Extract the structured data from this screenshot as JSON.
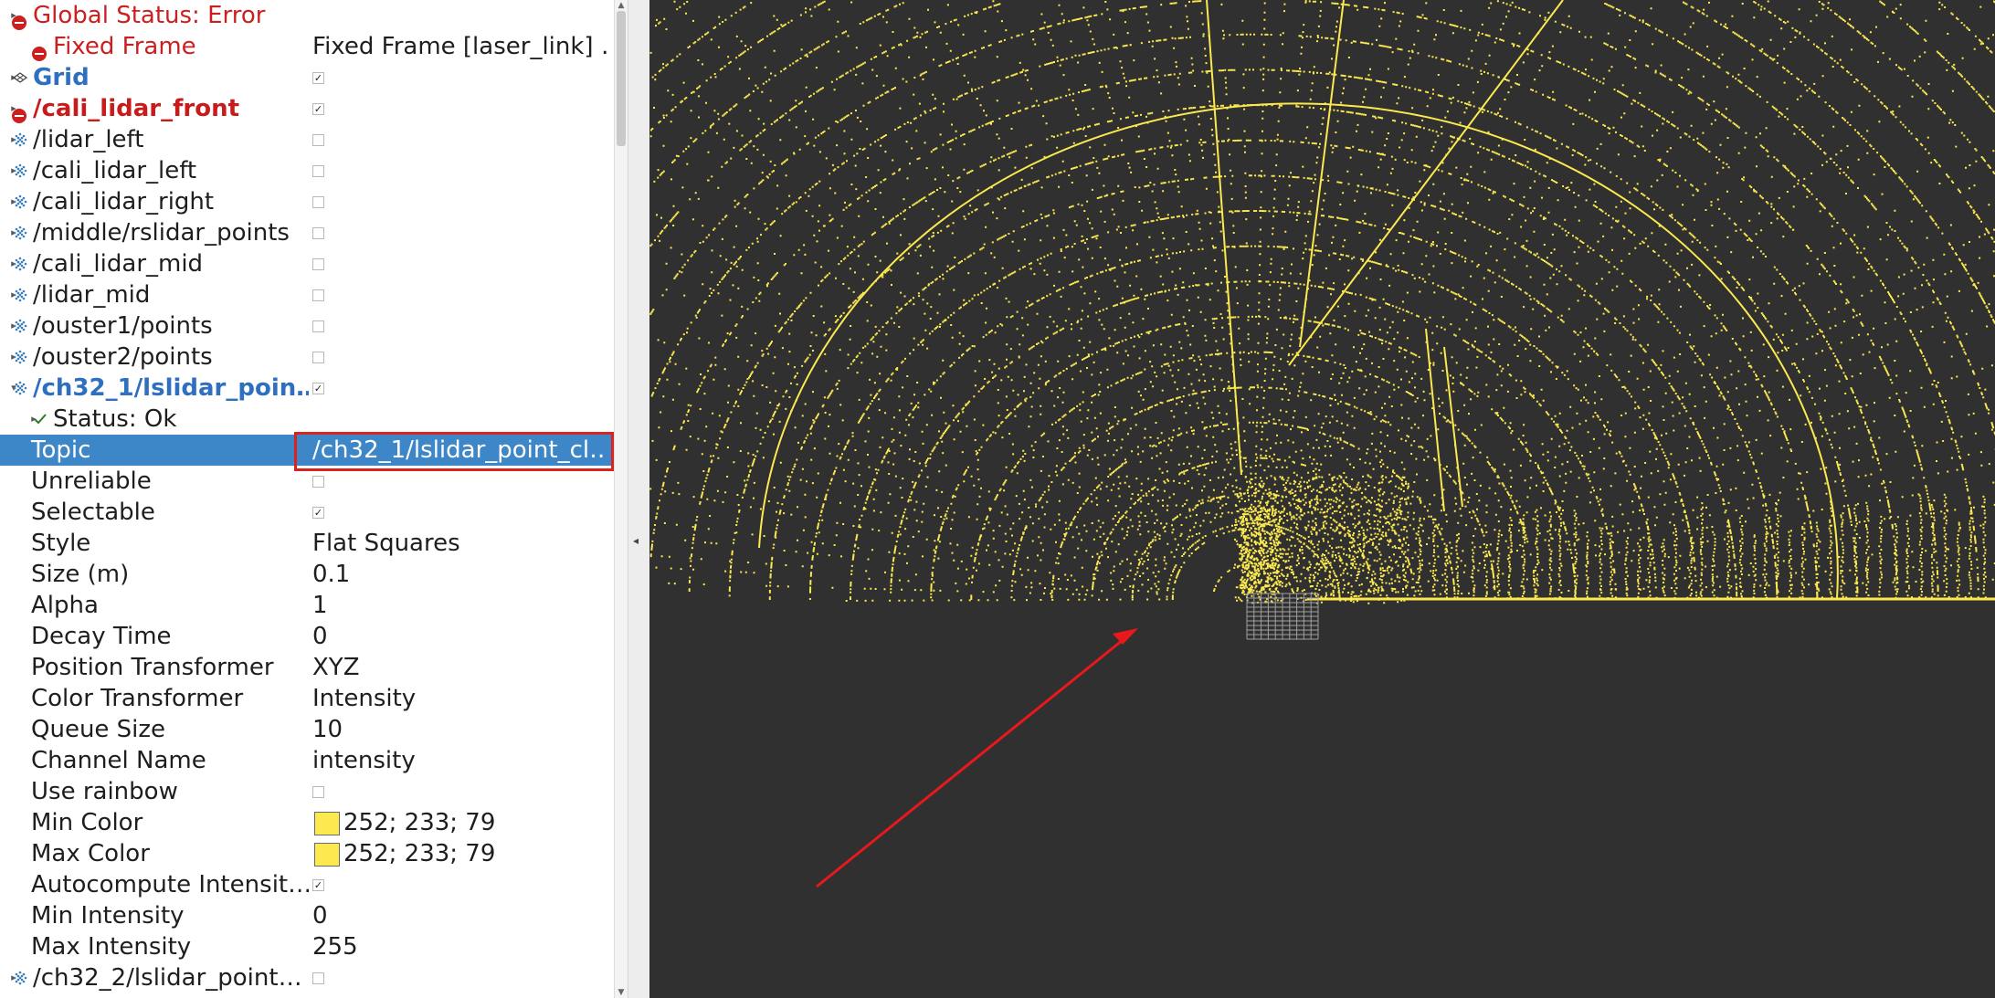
{
  "displays": [
    {
      "label": "Global Status: Error",
      "indent": 0,
      "icon": "error-icon",
      "arrow": "collapsed",
      "style": "err",
      "value_type": "none",
      "checked": null,
      "value": "",
      "name": "global-status-row"
    },
    {
      "label": "Fixed Frame",
      "indent": 1,
      "icon": "error-icon",
      "arrow": "none",
      "style": "err",
      "value_type": "text",
      "checked": null,
      "value": "Fixed Frame [laser_link] …",
      "name": "fixed-frame-row"
    },
    {
      "label": "Grid",
      "indent": 0,
      "icon": "grid-icon",
      "arrow": "collapsed",
      "style": "blue-bold",
      "value_type": "checkbox",
      "checked": true,
      "value": "",
      "name": "display-grid-row"
    },
    {
      "label": "/cali_lidar_front",
      "indent": 0,
      "icon": "error-icon",
      "arrow": "collapsed",
      "style": "red-bold",
      "value_type": "checkbox",
      "checked": true,
      "value": "",
      "name": "display-cali-lidar-front-row"
    },
    {
      "label": "/lidar_left",
      "indent": 0,
      "icon": "pointcloud-icon",
      "arrow": "collapsed",
      "style": "normal",
      "value_type": "checkbox",
      "checked": false,
      "value": "",
      "name": "display-lidar-left-row"
    },
    {
      "label": "/cali_lidar_left",
      "indent": 0,
      "icon": "pointcloud-icon",
      "arrow": "collapsed",
      "style": "normal",
      "value_type": "checkbox",
      "checked": false,
      "value": "",
      "name": "display-cali-lidar-left-row"
    },
    {
      "label": "/cali_lidar_right",
      "indent": 0,
      "icon": "pointcloud-icon",
      "arrow": "collapsed",
      "style": "normal",
      "value_type": "checkbox",
      "checked": false,
      "value": "",
      "name": "display-cali-lidar-right-row"
    },
    {
      "label": "/middle/rslidar_points",
      "indent": 0,
      "icon": "pointcloud-icon",
      "arrow": "collapsed",
      "style": "normal",
      "value_type": "checkbox",
      "checked": false,
      "value": "",
      "name": "display-middle-rslidar-row"
    },
    {
      "label": "/cali_lidar_mid",
      "indent": 0,
      "icon": "pointcloud-icon",
      "arrow": "collapsed",
      "style": "normal",
      "value_type": "checkbox",
      "checked": false,
      "value": "",
      "name": "display-cali-lidar-mid-row"
    },
    {
      "label": "/lidar_mid",
      "indent": 0,
      "icon": "pointcloud-icon",
      "arrow": "collapsed",
      "style": "normal",
      "value_type": "checkbox",
      "checked": false,
      "value": "",
      "name": "display-lidar-mid-row"
    },
    {
      "label": "/ouster1/points",
      "indent": 0,
      "icon": "pointcloud-icon",
      "arrow": "collapsed",
      "style": "normal",
      "value_type": "checkbox",
      "checked": false,
      "value": "",
      "name": "display-ouster1-row"
    },
    {
      "label": "/ouster2/points",
      "indent": 0,
      "icon": "pointcloud-icon",
      "arrow": "collapsed",
      "style": "normal",
      "value_type": "checkbox",
      "checked": false,
      "value": "",
      "name": "display-ouster2-row"
    },
    {
      "label": "/ch32_1/lslidar_poin…",
      "indent": 0,
      "icon": "pointcloud-icon",
      "arrow": "expanded",
      "style": "blue-bold",
      "value_type": "checkbox",
      "checked": true,
      "value": "",
      "name": "display-ch32-1-row"
    },
    {
      "label": "Status: Ok",
      "indent": 1,
      "icon": "ok-icon",
      "arrow": "collapsed",
      "style": "normal",
      "value_type": "none",
      "checked": null,
      "value": "",
      "name": "status-ok-row"
    },
    {
      "label": "Topic",
      "indent": 1,
      "icon": "",
      "arrow": "none",
      "style": "normal",
      "value_type": "text",
      "checked": null,
      "value": "/ch32_1/lslidar_point_cl…",
      "name": "prop-topic-row",
      "selected": true
    },
    {
      "label": "Unreliable",
      "indent": 1,
      "icon": "",
      "arrow": "none",
      "style": "normal",
      "value_type": "checkbox",
      "checked": false,
      "value": "",
      "name": "prop-unreliable-row"
    },
    {
      "label": "Selectable",
      "indent": 1,
      "icon": "",
      "arrow": "none",
      "style": "normal",
      "value_type": "checkbox",
      "checked": true,
      "value": "",
      "name": "prop-selectable-row"
    },
    {
      "label": "Style",
      "indent": 1,
      "icon": "",
      "arrow": "none",
      "style": "normal",
      "value_type": "text",
      "checked": null,
      "value": "Flat Squares",
      "name": "prop-style-row"
    },
    {
      "label": "Size (m)",
      "indent": 1,
      "icon": "",
      "arrow": "none",
      "style": "normal",
      "value_type": "text",
      "checked": null,
      "value": "0.1",
      "name": "prop-size-row"
    },
    {
      "label": "Alpha",
      "indent": 1,
      "icon": "",
      "arrow": "none",
      "style": "normal",
      "value_type": "text",
      "checked": null,
      "value": "1",
      "name": "prop-alpha-row"
    },
    {
      "label": "Decay Time",
      "indent": 1,
      "icon": "",
      "arrow": "none",
      "style": "normal",
      "value_type": "text",
      "checked": null,
      "value": "0",
      "name": "prop-decay-time-row"
    },
    {
      "label": "Position Transformer",
      "indent": 1,
      "icon": "",
      "arrow": "none",
      "style": "normal",
      "value_type": "text",
      "checked": null,
      "value": "XYZ",
      "name": "prop-position-transformer-row"
    },
    {
      "label": "Color Transformer",
      "indent": 1,
      "icon": "",
      "arrow": "none",
      "style": "normal",
      "value_type": "text",
      "checked": null,
      "value": "Intensity",
      "name": "prop-color-transformer-row"
    },
    {
      "label": "Queue Size",
      "indent": 1,
      "icon": "",
      "arrow": "none",
      "style": "normal",
      "value_type": "text",
      "checked": null,
      "value": "10",
      "name": "prop-queue-size-row"
    },
    {
      "label": "Channel Name",
      "indent": 1,
      "icon": "",
      "arrow": "none",
      "style": "normal",
      "value_type": "text",
      "checked": null,
      "value": "intensity",
      "name": "prop-channel-name-row"
    },
    {
      "label": "Use rainbow",
      "indent": 1,
      "icon": "",
      "arrow": "none",
      "style": "normal",
      "value_type": "checkbox",
      "checked": false,
      "value": "",
      "name": "prop-use-rainbow-row"
    },
    {
      "label": "Min Color",
      "indent": 1,
      "icon": "",
      "arrow": "none",
      "style": "normal",
      "value_type": "color",
      "checked": null,
      "value": "252; 233; 79",
      "color": "#fce94f",
      "name": "prop-min-color-row"
    },
    {
      "label": "Max Color",
      "indent": 1,
      "icon": "",
      "arrow": "none",
      "style": "normal",
      "value_type": "color",
      "checked": null,
      "value": "252; 233; 79",
      "color": "#fce94f",
      "name": "prop-max-color-row"
    },
    {
      "label": "Autocompute Intensit…",
      "indent": 1,
      "icon": "",
      "arrow": "none",
      "style": "normal",
      "value_type": "checkbox",
      "checked": true,
      "value": "",
      "name": "prop-autocompute-intensity-row"
    },
    {
      "label": "Min Intensity",
      "indent": 1,
      "icon": "",
      "arrow": "none",
      "style": "normal",
      "value_type": "text",
      "checked": null,
      "value": "0",
      "name": "prop-min-intensity-row"
    },
    {
      "label": "Max Intensity",
      "indent": 1,
      "icon": "",
      "arrow": "none",
      "style": "normal",
      "value_type": "text",
      "checked": null,
      "value": "255",
      "name": "prop-max-intensity-row"
    },
    {
      "label": "/ch32_2/lslidar_point…",
      "indent": 0,
      "icon": "pointcloud-icon",
      "arrow": "collapsed",
      "style": "normal",
      "value_type": "checkbox",
      "checked": false,
      "value": "",
      "name": "display-ch32-2-row"
    }
  ],
  "colors": {
    "selection": "#3d87c8",
    "error": "#cc1f1f",
    "display_blue": "#2f6fbf",
    "view_background": "#303030",
    "point_color": "#fce94f",
    "annotation_red": "#e8181c"
  }
}
